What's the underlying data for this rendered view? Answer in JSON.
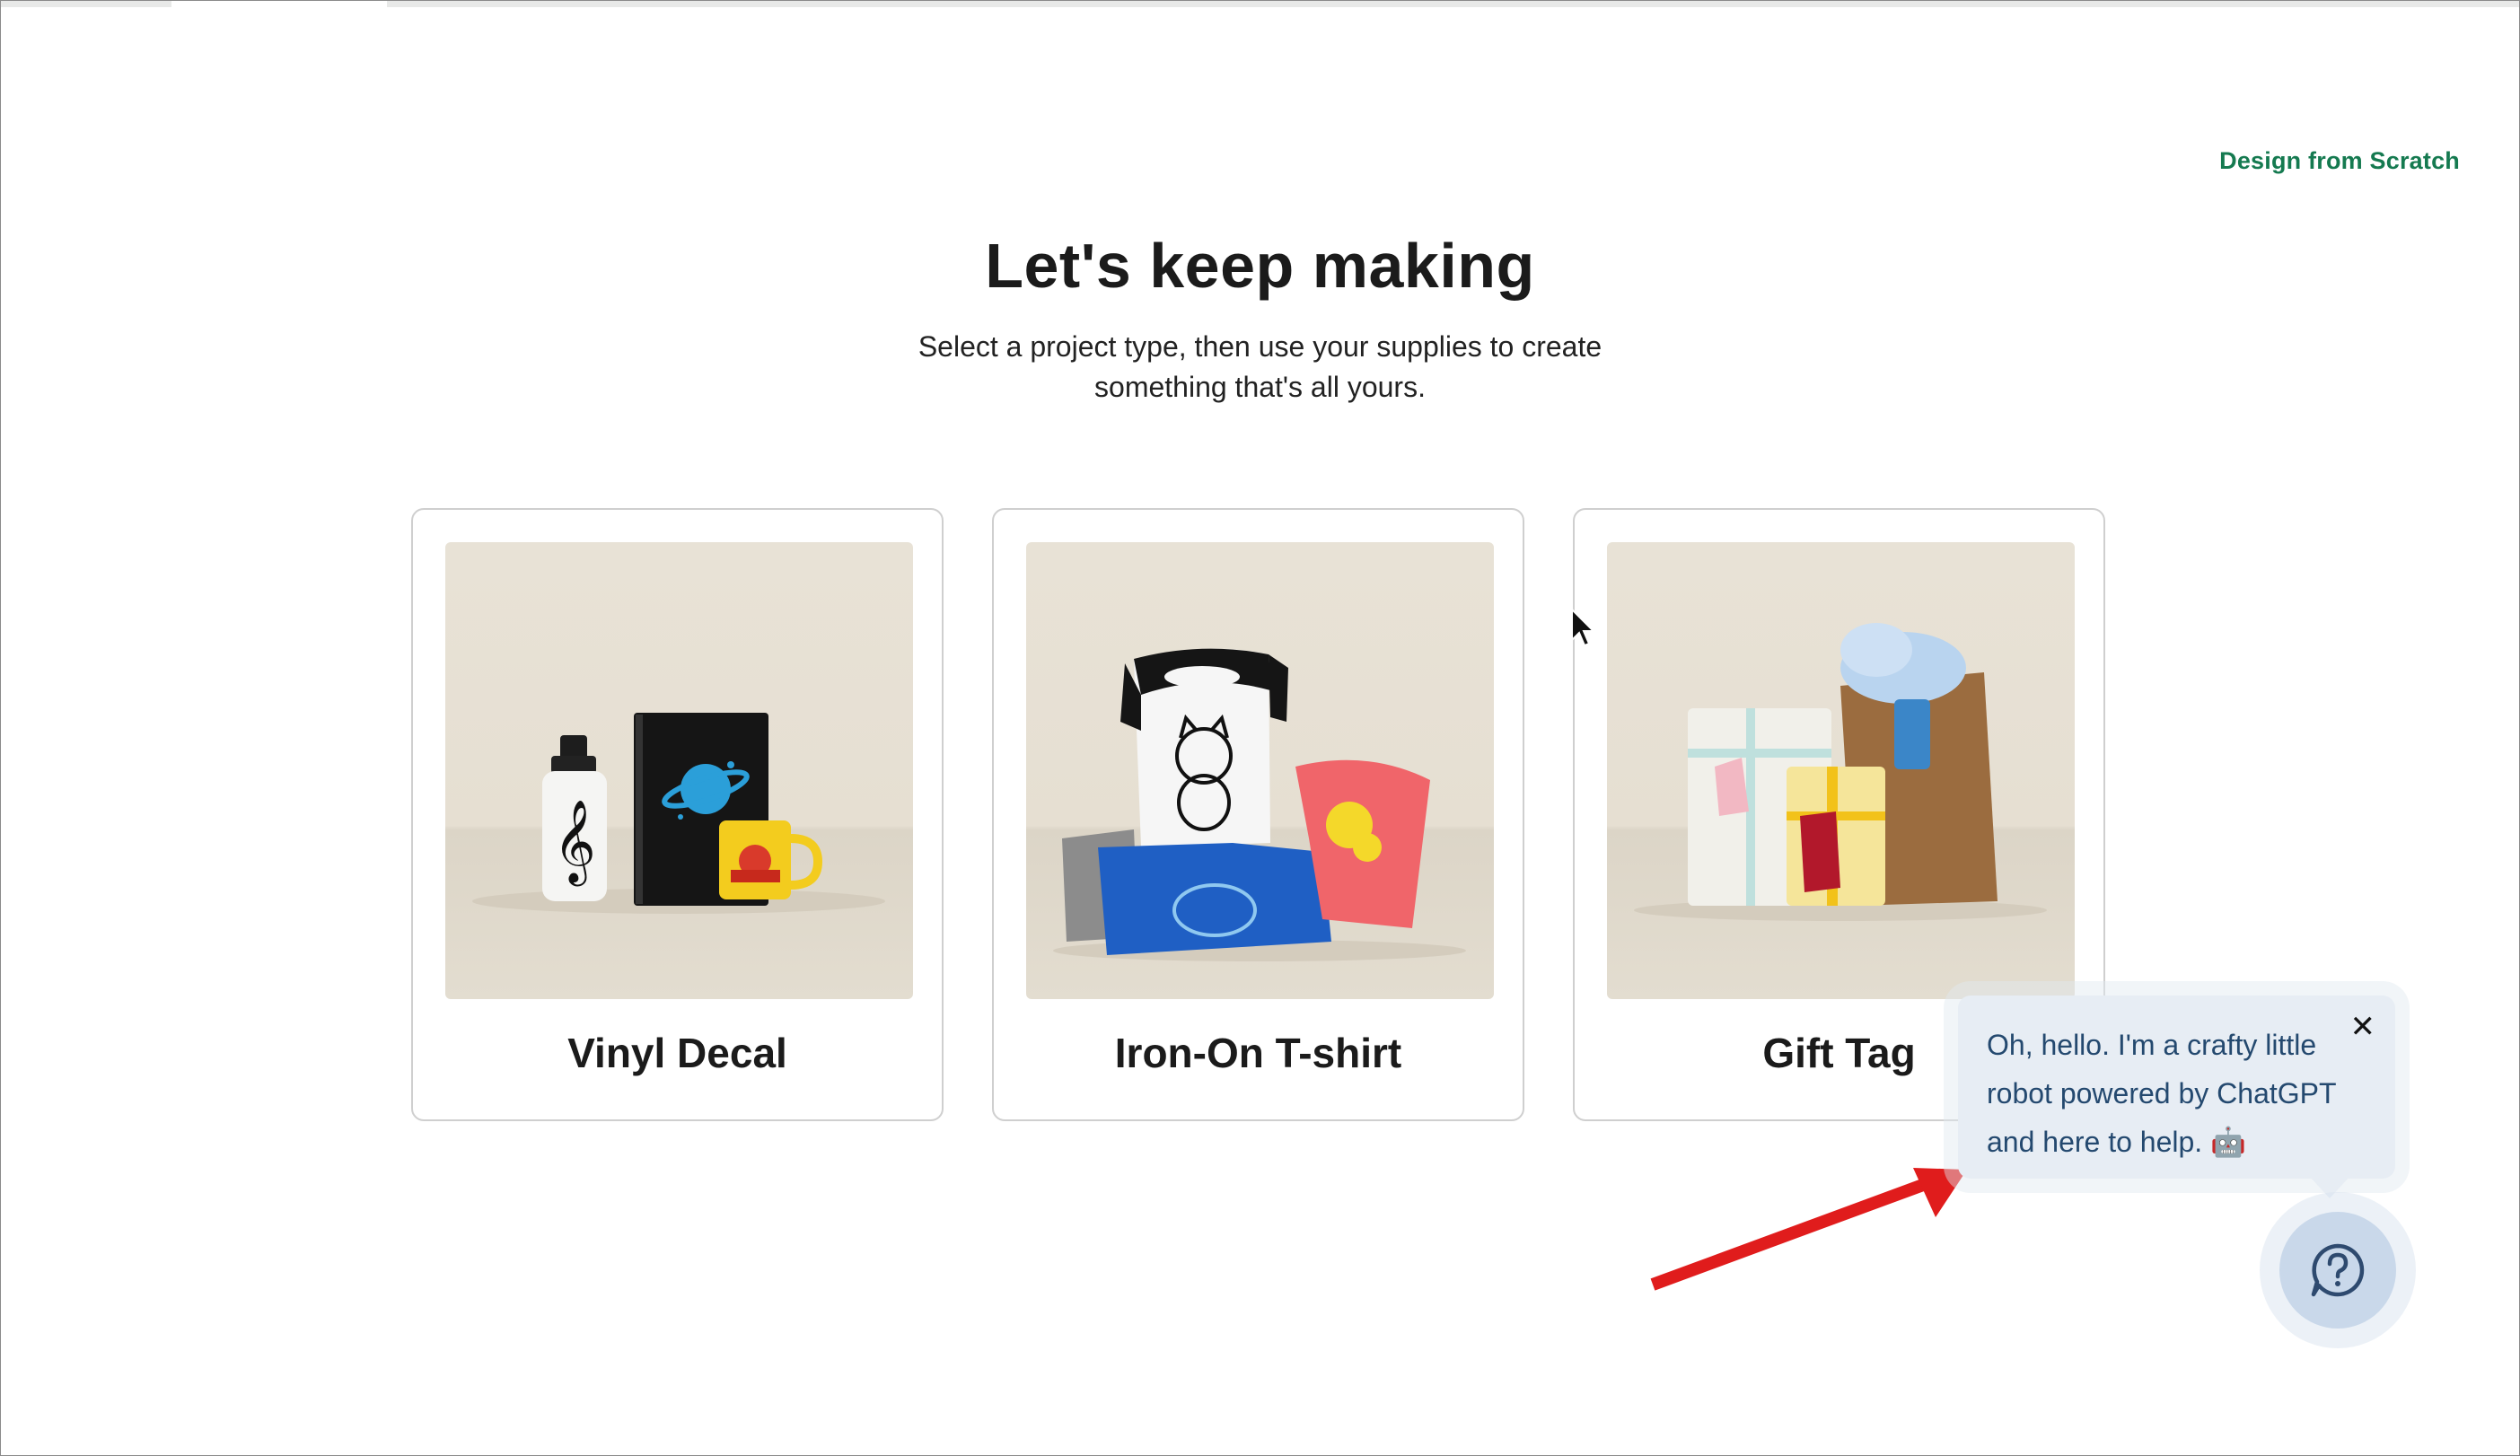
{
  "header": {
    "design_link": "Design from Scratch"
  },
  "hero": {
    "title": "Let's keep making",
    "subtitle": "Select a project type, then use your supplies to create something that's all yours."
  },
  "cards": [
    {
      "label": "Vinyl Decal",
      "image": "bottle-notebook-mug-photo"
    },
    {
      "label": "Iron-On T-shirt",
      "image": "tshirts-photo"
    },
    {
      "label": "Gift Tag",
      "image": "gift-bag-tags-photo"
    }
  ],
  "chat": {
    "message": "Oh, hello. I'm a crafty little robot powered by ChatGPT and here to help. 🤖",
    "close_icon": "close-icon",
    "help_icon": "question-bubble-icon"
  },
  "colors": {
    "accent": "#157a50",
    "bubble_bg": "#e7edf4",
    "bubble_text": "#24496f",
    "help_button": "#c9d8ea",
    "annotation_arrow": "#e01c1c"
  }
}
